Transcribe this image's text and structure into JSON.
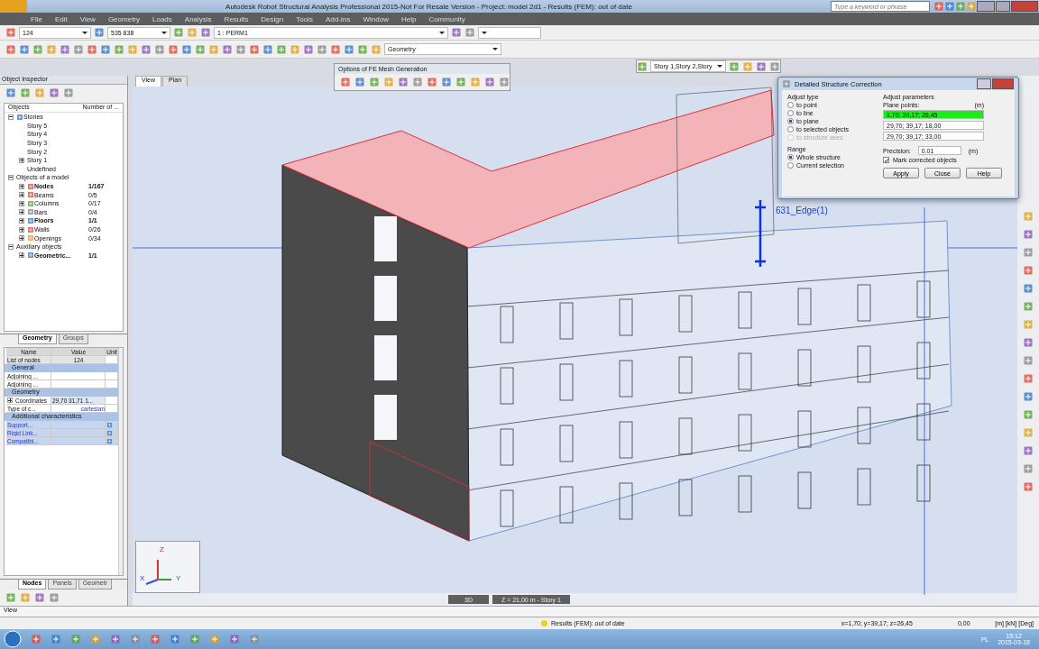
{
  "window": {
    "title": "Autodesk Robot Structural Analysis Professional 2015-Not For Resale Version - Project: model 2d1 - Results (FEM): out of date"
  },
  "search": {
    "placeholder": "Type a keyword or phrase"
  },
  "menu": [
    "File",
    "Edit",
    "View",
    "Geometry",
    "Loads",
    "Analysis",
    "Results",
    "Design",
    "Tools",
    "Add-Ins",
    "Window",
    "Help",
    "Community"
  ],
  "selection_bar": {
    "nodes": "124",
    "bars": "535 838",
    "load_case": "1 : PERM1",
    "layout": "Geometry"
  },
  "mesh_palette": {
    "title": "Options of FE Mesh Generation"
  },
  "story_bar": {
    "value": "Story 1,Story 2,Story"
  },
  "view_tabs": [
    {
      "label": "View",
      "selected": true
    },
    {
      "label": "Plan",
      "selected": false
    }
  ],
  "inspector": {
    "title": "Object Inspector",
    "columns": [
      "Objects",
      "Number of ..."
    ],
    "tree": [
      {
        "label": "Stories",
        "kind": "group",
        "bold": false,
        "expanded": true,
        "children": [
          {
            "label": "Story 5",
            "kind": "story",
            "bold": false
          },
          {
            "label": "Story 4",
            "kind": "story",
            "bold": false
          },
          {
            "label": "Story 3",
            "kind": "story",
            "bold": false
          },
          {
            "label": "Story 2",
            "kind": "story",
            "bold": false
          },
          {
            "label": "Story 1",
            "kind": "story",
            "bold": false,
            "expanded": false
          },
          {
            "label": "Undefined",
            "kind": "story",
            "bold": false
          }
        ]
      },
      {
        "label": "Objects of a model",
        "kind": "folder",
        "bold": false,
        "expanded": true,
        "children": [
          {
            "label": "Nodes",
            "count": "1/167",
            "kind": "object",
            "bold": true,
            "expanded": false
          },
          {
            "label": "Beams",
            "count": "0/5",
            "kind": "object",
            "bold": false,
            "expanded": false
          },
          {
            "label": "Columns",
            "count": "0/17",
            "kind": "object",
            "bold": false,
            "expanded": false
          },
          {
            "label": "Bars",
            "count": "0/4",
            "kind": "object",
            "bold": false,
            "expanded": false
          },
          {
            "label": "Floors",
            "count": "1/1",
            "kind": "object",
            "bold": true,
            "expanded": false
          },
          {
            "label": "Walls",
            "count": "0/26",
            "kind": "object",
            "bold": false,
            "expanded": false
          },
          {
            "label": "Openings",
            "count": "0/34",
            "kind": "object",
            "bold": false,
            "expanded": false
          }
        ]
      },
      {
        "label": "Auxiliary objects",
        "kind": "folder",
        "bold": false,
        "expanded": true,
        "children": [
          {
            "label": "Geometric...",
            "count": "1/1",
            "kind": "object",
            "bold": true,
            "expanded": false
          }
        ]
      }
    ],
    "tabs": [
      {
        "label": "Geometry",
        "selected": true
      },
      {
        "label": "Groups",
        "selected": false
      }
    ]
  },
  "properties": {
    "columns": [
      "Name",
      "Value",
      "Unit"
    ],
    "rows": [
      {
        "kind": "header",
        "name": "List of nodes",
        "value": "124"
      },
      {
        "kind": "section",
        "name": "General"
      },
      {
        "kind": "field",
        "name": "Adjoining ..."
      },
      {
        "kind": "field",
        "name": "Adjoining ..."
      },
      {
        "kind": "section",
        "name": "Geometry"
      },
      {
        "kind": "field",
        "name": "Coordinates",
        "value": "29,70 31,71 1...",
        "expanded": false
      },
      {
        "kind": "field",
        "name": "Type of c...",
        "value": "cartesian"
      },
      {
        "kind": "section",
        "name": "Additional characteristics"
      },
      {
        "kind": "link",
        "name": "Support..."
      },
      {
        "kind": "link",
        "name": "Rigid Link..."
      },
      {
        "kind": "link",
        "name": "Compatibi..."
      }
    ],
    "tabs": [
      {
        "label": "Nodes",
        "selected": true
      },
      {
        "label": "Panels",
        "selected": false
      },
      {
        "label": "Geometr",
        "selected": false
      }
    ]
  },
  "command_line": {
    "value": "View"
  },
  "viewport": {
    "edge_label": "631_Edge(1)",
    "axes": [
      "Z",
      "X",
      "Y"
    ],
    "tabs": [
      "3D",
      "Z = 21,00 m - Story 1"
    ]
  },
  "dialog": {
    "title": "Detailed Structure Correction",
    "adjust_type": "Adjust type",
    "types": [
      {
        "label": "to point",
        "selected": false,
        "disabled": false
      },
      {
        "label": "to line",
        "selected": false,
        "disabled": false
      },
      {
        "label": "to plane",
        "selected": true,
        "disabled": false
      },
      {
        "label": "to selected objects",
        "selected": false,
        "disabled": false
      },
      {
        "label": "to structure axes",
        "selected": false,
        "disabled": true
      }
    ],
    "parameters": "Adjust parameters",
    "points_label": "Plane points:",
    "unit": "(m)",
    "points": [
      {
        "value": "1,70; 39,17; 26,45",
        "highlighted": true
      },
      {
        "value": "29,70; 39,17; 18,00",
        "highlighted": false
      },
      {
        "value": "29,70; 39,17; 33,00",
        "highlighted": false
      }
    ],
    "range": "Range",
    "ranges": [
      {
        "label": "Whole structure",
        "selected": true
      },
      {
        "label": "Current selection",
        "selected": false
      }
    ],
    "precision_label": "Precision:",
    "precision": "0.01",
    "precision_unit": "(m)",
    "mark": {
      "label": "Mark corrected objects",
      "checked": true
    },
    "buttons": [
      "Apply",
      "Close",
      "Help"
    ]
  },
  "status": {
    "message": "Results (FEM): out of date",
    "coords": "x=1,70; y=39,17; z=26,45",
    "value": "0,00",
    "units": "[m] [kN] [Deg]"
  },
  "taskbar": {
    "language": "PL",
    "time": "15:12",
    "date": "2015-03-18"
  }
}
